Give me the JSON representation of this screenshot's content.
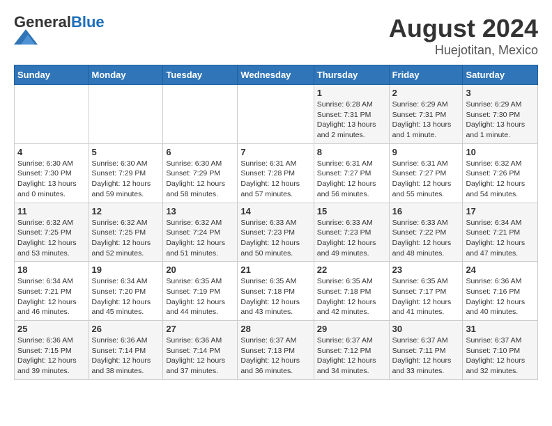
{
  "header": {
    "logo_general": "General",
    "logo_blue": "Blue",
    "month": "August 2024",
    "location": "Huejotitan, Mexico"
  },
  "days_of_week": [
    "Sunday",
    "Monday",
    "Tuesday",
    "Wednesday",
    "Thursday",
    "Friday",
    "Saturday"
  ],
  "weeks": [
    [
      {
        "day": "",
        "info": ""
      },
      {
        "day": "",
        "info": ""
      },
      {
        "day": "",
        "info": ""
      },
      {
        "day": "",
        "info": ""
      },
      {
        "day": "1",
        "info": "Sunrise: 6:28 AM\nSunset: 7:31 PM\nDaylight: 13 hours\nand 2 minutes."
      },
      {
        "day": "2",
        "info": "Sunrise: 6:29 AM\nSunset: 7:31 PM\nDaylight: 13 hours\nand 1 minute."
      },
      {
        "day": "3",
        "info": "Sunrise: 6:29 AM\nSunset: 7:30 PM\nDaylight: 13 hours\nand 1 minute."
      }
    ],
    [
      {
        "day": "4",
        "info": "Sunrise: 6:30 AM\nSunset: 7:30 PM\nDaylight: 13 hours\nand 0 minutes."
      },
      {
        "day": "5",
        "info": "Sunrise: 6:30 AM\nSunset: 7:29 PM\nDaylight: 12 hours\nand 59 minutes."
      },
      {
        "day": "6",
        "info": "Sunrise: 6:30 AM\nSunset: 7:29 PM\nDaylight: 12 hours\nand 58 minutes."
      },
      {
        "day": "7",
        "info": "Sunrise: 6:31 AM\nSunset: 7:28 PM\nDaylight: 12 hours\nand 57 minutes."
      },
      {
        "day": "8",
        "info": "Sunrise: 6:31 AM\nSunset: 7:27 PM\nDaylight: 12 hours\nand 56 minutes."
      },
      {
        "day": "9",
        "info": "Sunrise: 6:31 AM\nSunset: 7:27 PM\nDaylight: 12 hours\nand 55 minutes."
      },
      {
        "day": "10",
        "info": "Sunrise: 6:32 AM\nSunset: 7:26 PM\nDaylight: 12 hours\nand 54 minutes."
      }
    ],
    [
      {
        "day": "11",
        "info": "Sunrise: 6:32 AM\nSunset: 7:25 PM\nDaylight: 12 hours\nand 53 minutes."
      },
      {
        "day": "12",
        "info": "Sunrise: 6:32 AM\nSunset: 7:25 PM\nDaylight: 12 hours\nand 52 minutes."
      },
      {
        "day": "13",
        "info": "Sunrise: 6:32 AM\nSunset: 7:24 PM\nDaylight: 12 hours\nand 51 minutes."
      },
      {
        "day": "14",
        "info": "Sunrise: 6:33 AM\nSunset: 7:23 PM\nDaylight: 12 hours\nand 50 minutes."
      },
      {
        "day": "15",
        "info": "Sunrise: 6:33 AM\nSunset: 7:23 PM\nDaylight: 12 hours\nand 49 minutes."
      },
      {
        "day": "16",
        "info": "Sunrise: 6:33 AM\nSunset: 7:22 PM\nDaylight: 12 hours\nand 48 minutes."
      },
      {
        "day": "17",
        "info": "Sunrise: 6:34 AM\nSunset: 7:21 PM\nDaylight: 12 hours\nand 47 minutes."
      }
    ],
    [
      {
        "day": "18",
        "info": "Sunrise: 6:34 AM\nSunset: 7:21 PM\nDaylight: 12 hours\nand 46 minutes."
      },
      {
        "day": "19",
        "info": "Sunrise: 6:34 AM\nSunset: 7:20 PM\nDaylight: 12 hours\nand 45 minutes."
      },
      {
        "day": "20",
        "info": "Sunrise: 6:35 AM\nSunset: 7:19 PM\nDaylight: 12 hours\nand 44 minutes."
      },
      {
        "day": "21",
        "info": "Sunrise: 6:35 AM\nSunset: 7:18 PM\nDaylight: 12 hours\nand 43 minutes."
      },
      {
        "day": "22",
        "info": "Sunrise: 6:35 AM\nSunset: 7:18 PM\nDaylight: 12 hours\nand 42 minutes."
      },
      {
        "day": "23",
        "info": "Sunrise: 6:35 AM\nSunset: 7:17 PM\nDaylight: 12 hours\nand 41 minutes."
      },
      {
        "day": "24",
        "info": "Sunrise: 6:36 AM\nSunset: 7:16 PM\nDaylight: 12 hours\nand 40 minutes."
      }
    ],
    [
      {
        "day": "25",
        "info": "Sunrise: 6:36 AM\nSunset: 7:15 PM\nDaylight: 12 hours\nand 39 minutes."
      },
      {
        "day": "26",
        "info": "Sunrise: 6:36 AM\nSunset: 7:14 PM\nDaylight: 12 hours\nand 38 minutes."
      },
      {
        "day": "27",
        "info": "Sunrise: 6:36 AM\nSunset: 7:14 PM\nDaylight: 12 hours\nand 37 minutes."
      },
      {
        "day": "28",
        "info": "Sunrise: 6:37 AM\nSunset: 7:13 PM\nDaylight: 12 hours\nand 36 minutes."
      },
      {
        "day": "29",
        "info": "Sunrise: 6:37 AM\nSunset: 7:12 PM\nDaylight: 12 hours\nand 34 minutes."
      },
      {
        "day": "30",
        "info": "Sunrise: 6:37 AM\nSunset: 7:11 PM\nDaylight: 12 hours\nand 33 minutes."
      },
      {
        "day": "31",
        "info": "Sunrise: 6:37 AM\nSunset: 7:10 PM\nDaylight: 12 hours\nand 32 minutes."
      }
    ]
  ]
}
